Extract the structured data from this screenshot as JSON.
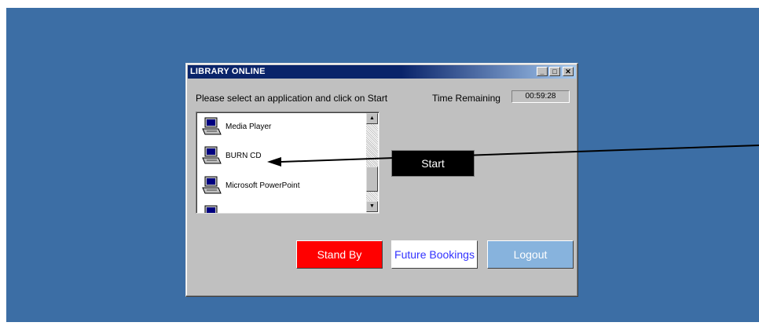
{
  "window": {
    "title": "LIBRARY ONLINE",
    "controls": {
      "minimize": "_",
      "maximize": "□",
      "close": "✕"
    }
  },
  "prompt": "Please select an application and click on Start",
  "timer": {
    "label": "Time Remaining",
    "value": "00:59:28"
  },
  "applications": [
    {
      "label": "Media Player",
      "icon": "computer-icon"
    },
    {
      "label": "BURN CD",
      "icon": "computer-icon"
    },
    {
      "label": "Microsoft PowerPoint",
      "icon": "computer-icon"
    },
    {
      "label": "",
      "icon": "computer-icon"
    }
  ],
  "scrollbar": {
    "up": "▲",
    "down": "▼"
  },
  "buttons": {
    "start": "Start",
    "standby": "Stand By",
    "bookings": "Future Bookings",
    "logout": "Logout"
  },
  "colors": {
    "desktop": "#3c6ea5",
    "titlebar": "#0a246a",
    "standby": "#ff0000",
    "bookings_text": "#3333ff",
    "logout": "#87b3dd",
    "start": "#000000"
  }
}
